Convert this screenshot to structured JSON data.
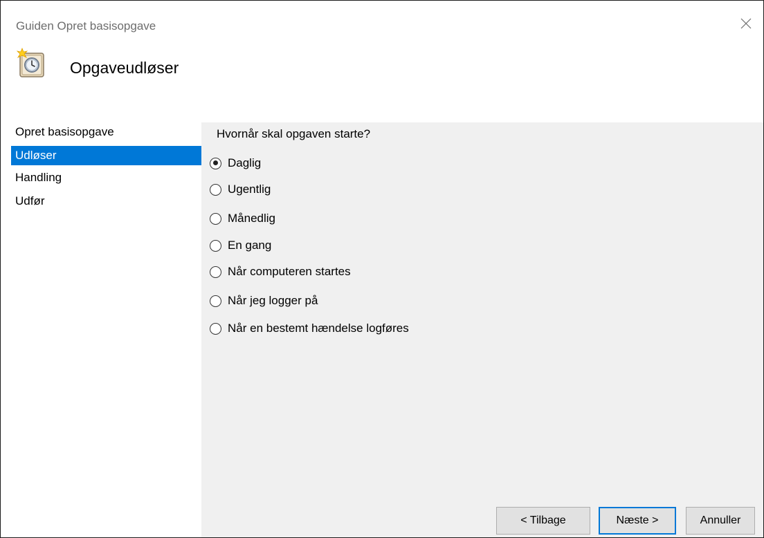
{
  "window": {
    "title": "Guiden Opret basisopgave"
  },
  "header": {
    "title": "Opgaveudløser",
    "icon": "clock-task-icon"
  },
  "sidebar": {
    "items": [
      {
        "label": "Opret basisopgave",
        "selected": false
      },
      {
        "label": "Udløser",
        "selected": true
      },
      {
        "label": "Handling",
        "selected": false
      },
      {
        "label": "Udfør",
        "selected": false
      }
    ]
  },
  "main": {
    "question": "Hvornår skal opgaven starte?",
    "options": [
      {
        "label": "Daglig",
        "checked": true
      },
      {
        "label": "Ugentlig",
        "checked": false
      },
      {
        "label": "Månedlig",
        "checked": false
      },
      {
        "label": "En gang",
        "checked": false
      },
      {
        "label": "Når computeren startes",
        "checked": false
      },
      {
        "label": "Når jeg logger på",
        "checked": false
      },
      {
        "label": "Når en bestemt hændelse logføres",
        "checked": false
      }
    ]
  },
  "footer": {
    "back_label": "< Tilbage",
    "next_label": "Næste >",
    "cancel_label": "Annuller"
  },
  "colors": {
    "selection": "#0078d7",
    "panel": "#f0f0f0",
    "default_button_border": "#0078d7"
  }
}
